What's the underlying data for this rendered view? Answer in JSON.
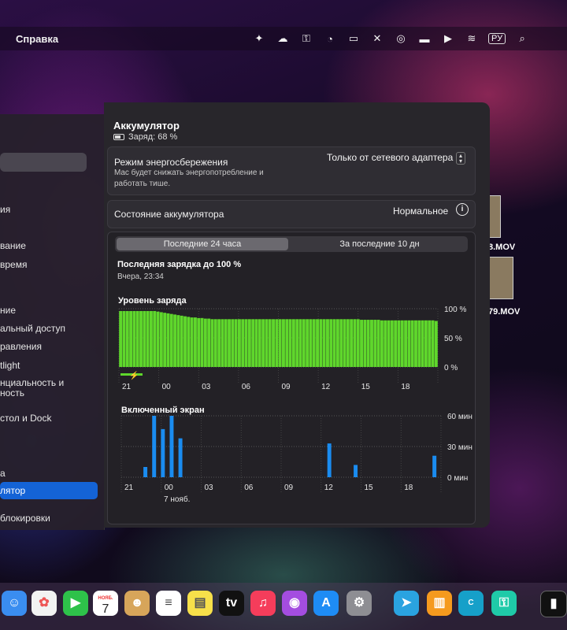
{
  "menubar": {
    "app_menu": "Справка",
    "language": "РУ"
  },
  "sidebar": {
    "items": [
      {
        "label": "ия"
      },
      {
        "label": "вание"
      },
      {
        "label": "время"
      },
      {
        "label": "ние"
      },
      {
        "label": "альный доступ"
      },
      {
        "label": "равления"
      },
      {
        "label": "tlight"
      },
      {
        "label": "нциальность и"
      },
      {
        "label": "ность"
      },
      {
        "label": "стол и Dock"
      },
      {
        "label": "а"
      },
      {
        "label": "лятор"
      },
      {
        "label": "блокировки"
      }
    ],
    "selected_index": 11
  },
  "panel": {
    "title": "Аккумулятор",
    "charge_text": "Заряд: 68 %",
    "power_mode": {
      "label": "Режим энергосбережения",
      "description": "Mac будет снижать энергопотребление и работать тише.",
      "value": "Только от сетевого адаптера"
    },
    "battery_health": {
      "label": "Состояние аккумулятора",
      "value": "Нормальное"
    },
    "tabs": [
      {
        "label": "Последние 24 часа",
        "active": true
      },
      {
        "label": "За последние 10 дн",
        "active": false
      }
    ],
    "last_charge": {
      "title": "Последняя зарядка до 100 %",
      "time": "Вчера, 23:34"
    }
  },
  "chart_data": [
    {
      "type": "bar",
      "title": "Уровень заряда",
      "ylim": [
        0,
        100
      ],
      "yticks": [
        "100 %",
        "50 %",
        "0 %"
      ],
      "xticks": [
        "21",
        "00",
        "03",
        "06",
        "09",
        "12",
        "15",
        "18"
      ],
      "values": [
        96,
        96,
        96,
        96,
        96,
        96,
        96,
        96,
        96,
        96,
        96,
        95,
        94,
        93,
        92,
        91,
        90,
        89,
        88,
        87,
        86,
        85,
        85,
        84,
        84,
        83,
        83,
        82,
        82,
        82,
        82,
        82,
        82,
        82,
        82,
        82,
        82,
        82,
        82,
        82,
        82,
        82,
        82,
        82,
        82,
        82,
        82,
        82,
        82,
        82,
        82,
        82,
        82,
        82,
        82,
        82,
        82,
        82,
        82,
        82,
        82,
        82,
        82,
        82,
        82,
        82,
        82,
        82,
        82,
        82,
        82,
        81,
        81,
        81,
        81,
        81,
        81,
        80,
        80,
        80,
        80,
        80,
        80,
        80,
        80,
        80,
        80,
        80,
        80,
        80,
        80,
        80,
        80,
        79
      ],
      "color": "#5fd72c",
      "charging_indicator": true
    },
    {
      "type": "bar",
      "title": "Включенный экран",
      "ylim": [
        0,
        60
      ],
      "yticks": [
        "60 мин",
        "30 мин",
        "0 мин"
      ],
      "xticks": [
        "21",
        "00",
        "03",
        "06",
        "09",
        "12",
        "15",
        "18"
      ],
      "date_label": "7 нояб.",
      "values": [
        0,
        0,
        0,
        0,
        0,
        10,
        0,
        60,
        0,
        47,
        0,
        60,
        0,
        38,
        0,
        0,
        0,
        0,
        0,
        0,
        0,
        0,
        0,
        0,
        0,
        0,
        0,
        0,
        0,
        0,
        0,
        0,
        0,
        0,
        0,
        0,
        0,
        0,
        0,
        0,
        0,
        0,
        0,
        0,
        0,
        0,
        0,
        33,
        0,
        0,
        0,
        0,
        0,
        12,
        0,
        0,
        0,
        0,
        0,
        0,
        0,
        0,
        0,
        0,
        0,
        0,
        0,
        0,
        0,
        0,
        0,
        21,
        0
      ],
      "color": "#1a8cf0"
    }
  ],
  "desktop": {
    "files": [
      "8.MOV",
      "79.MOV"
    ]
  },
  "dock": {
    "calendar_month": "НОЯБ.",
    "calendar_day": "7",
    "apps": [
      "finder",
      "photos",
      "facetime",
      "calendar",
      "contacts",
      "reminders",
      "notes",
      "tv",
      "music",
      "podcasts",
      "app-store",
      "settings",
      "telegram",
      "books",
      "canva",
      "keychain",
      "terminal"
    ]
  }
}
